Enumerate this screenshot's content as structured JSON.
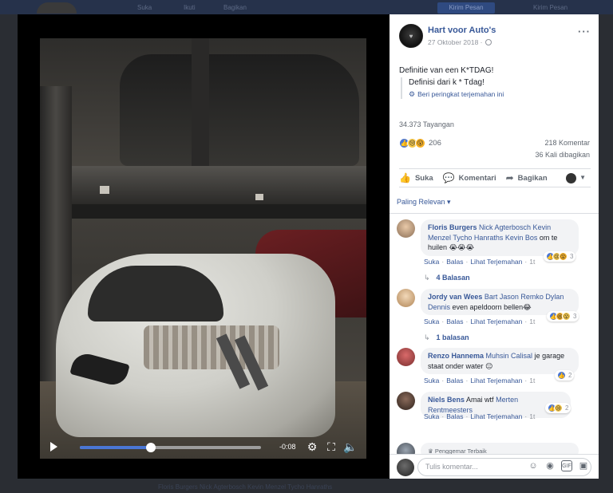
{
  "backdrop": {
    "tabs": [
      "Suka",
      "Ikuti",
      "Bagikan"
    ],
    "send_message": "Kirim Pesan",
    "follow": "Kirim Pesan",
    "bottom_text": "Floris Burgers Nick Agterbosch Kevin Menzel Tycho Hanraths"
  },
  "video": {
    "time_remaining": "-0:08",
    "progress_fraction": 0.39
  },
  "post": {
    "page_name": "Hart voor Auto's",
    "date": "27 Oktober 2018 ·",
    "text": "Definitie van een K*TDAG!",
    "translation": "Definisi dari k * Tdag!",
    "rate_translation": "Beri peringkat terjemahan ini",
    "views": "34.373 Tayangan",
    "reaction_count": "206",
    "comments_count": "218 Komentar",
    "shares_count": "36 Kali dibagikan"
  },
  "actions": {
    "like": "Suka",
    "comment": "Komentari",
    "share": "Bagikan"
  },
  "sort_label": "Paling Relevan ▾",
  "comments": [
    {
      "author": "Floris Burgers",
      "tags": "Nick Agterbosch Kevin Menzel Tycho Hanraths Kevin Bos",
      "text": "om te huilen 😭😭😭",
      "reply_label": "Suka",
      "reply2": "Balas",
      "translate": "Lihat Terjemahan",
      "time": "1t",
      "reaction_count": "3",
      "replies": "4 Balasan"
    },
    {
      "author": "Jordy van Wees",
      "tags": "Bart Jason Remko Dylan Dennis",
      "text": "even apeldoorn bellen😂",
      "reply_label": "Suka",
      "reply2": "Balas",
      "translate": "Lihat Terjemahan",
      "time": "1t",
      "reaction_count": "3",
      "replies": "1 balasan"
    },
    {
      "author": "Renzo Hannema",
      "tags": "Muhsin Calisal",
      "text": "je garage staat onder water 😑",
      "reply_label": "Suka",
      "reply2": "Balas",
      "translate": "Lihat Terjemahan",
      "time": "1t",
      "reaction_count": "2"
    },
    {
      "author": "Niels Bens",
      "tags": "Merten Rentmeesters",
      "text": "Amai wtf",
      "reply_label": "Suka",
      "reply2": "Balas",
      "translate": "Lihat Terjemahan",
      "time": "1t",
      "reaction_count": "2"
    }
  ],
  "top_fan": "Penggemar Terbaik",
  "composer_placeholder": "Tulis komentar...",
  "colors": {
    "link": "#385898",
    "accent": "#4a76d4",
    "bubble": "#f2f3f5"
  }
}
